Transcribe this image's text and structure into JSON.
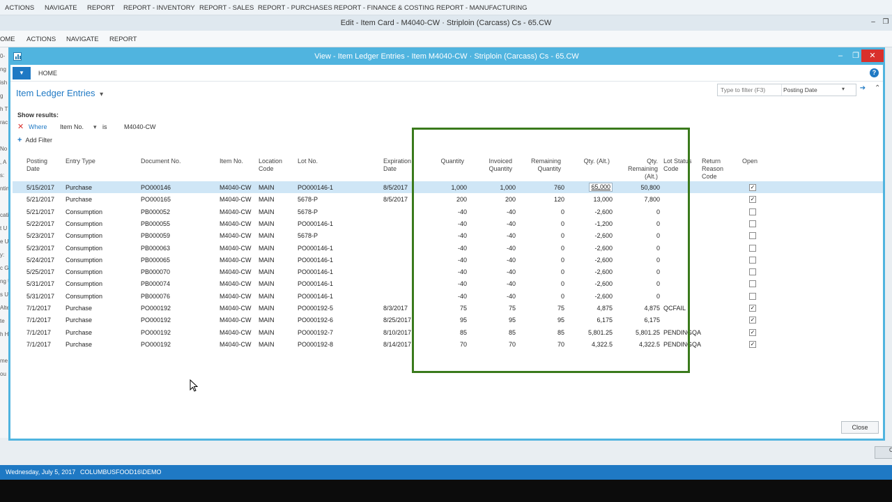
{
  "background_app": {
    "menu": [
      "ACTIONS",
      "NAVIGATE",
      "REPORT",
      "REPORT - INVENTORY",
      "REPORT - SALES",
      "REPORT - PURCHASES",
      "REPORT - FINANCE & COSTING",
      "REPORT - MANUFACTURING"
    ],
    "title": "Edit - Item Card - M4040-CW · Striploin (Carcass) Cs - 65.CW",
    "ribbon": [
      "OME",
      "ACTIONS",
      "NAVIGATE",
      "REPORT"
    ],
    "left_fragments": [
      "0-",
      "ng",
      "ish",
      "g",
      "h T",
      "rac",
      "",
      "No",
      ", A",
      "s:",
      "ntin",
      "",
      "cati",
      "t U",
      "e U",
      "y:",
      "c G",
      "ng U",
      "s U",
      "Alte",
      "te",
      "h H",
      "",
      "me",
      "ou"
    ],
    "corner_btn": "C"
  },
  "window": {
    "title": "View - Item Ledger Entries - Item M4040-CW · Striploin (Carcass) Cs - 65.CW",
    "minimize": "–",
    "maximize": "❐",
    "close": "✕"
  },
  "ribbon": {
    "tab": "HOME",
    "dropdown": "▼",
    "help": "?"
  },
  "page": {
    "title": "Item Ledger Entries",
    "title_chevron": "▾"
  },
  "search": {
    "placeholder": "Type to filter (F3)",
    "field": "Posting Date",
    "chevron": "▾",
    "go": "➔",
    "collapse": "⌃"
  },
  "filters": {
    "show_results": "Show results:",
    "remove": "✕",
    "where": "Where",
    "field": "Item No.",
    "field_chevron": "▾",
    "operator": "is",
    "value": "M4040-CW",
    "add_label": "Add Filter",
    "add_icon": "+"
  },
  "columns": {
    "posting_date": "Posting\nDate",
    "entry_type": "Entry Type",
    "document_no": "Document No.",
    "item_no": "Item No.",
    "location_code": "Location\nCode",
    "lot_no": "Lot No.",
    "expiration_date": "Expiration\nDate",
    "quantity": "Quantity",
    "invoiced_quantity": "Invoiced\nQuantity",
    "remaining_quantity": "Remaining\nQuantity",
    "qty_alt": "Qty. (Alt.)",
    "qty_remaining_alt": "Qty.\nRemaining\n(Alt.)",
    "lot_status_code": "Lot Status\nCode",
    "return_reason_code": "Return\nReason\nCode",
    "open": "Open"
  },
  "rows": [
    {
      "date": "5/15/2017",
      "type": "Purchase",
      "doc": "PO000146",
      "item": "M4040-CW",
      "loc": "MAIN",
      "lot": "PO000146-1",
      "exp": "8/5/2017",
      "qty": "1,000",
      "inv": "1,000",
      "rem": "760",
      "alt": "65,000",
      "remalt": "50,800",
      "lotstatus": "",
      "reason": "",
      "open": "✓"
    },
    {
      "date": "5/21/2017",
      "type": "Purchase",
      "doc": "PO000165",
      "item": "M4040-CW",
      "loc": "MAIN",
      "lot": "5678-P",
      "exp": "8/5/2017",
      "qty": "200",
      "inv": "200",
      "rem": "120",
      "alt": "13,000",
      "remalt": "7,800",
      "lotstatus": "",
      "reason": "",
      "open": "✓"
    },
    {
      "date": "5/21/2017",
      "type": "Consumption",
      "doc": "PB000052",
      "item": "M4040-CW",
      "loc": "MAIN",
      "lot": "5678-P",
      "exp": "",
      "qty": "-40",
      "inv": "-40",
      "rem": "0",
      "alt": "-2,600",
      "remalt": "0",
      "lotstatus": "",
      "reason": "",
      "open": ""
    },
    {
      "date": "5/22/2017",
      "type": "Consumption",
      "doc": "PB000055",
      "item": "M4040-CW",
      "loc": "MAIN",
      "lot": "PO000146-1",
      "exp": "",
      "qty": "-40",
      "inv": "-40",
      "rem": "0",
      "alt": "-1,200",
      "remalt": "0",
      "lotstatus": "",
      "reason": "",
      "open": ""
    },
    {
      "date": "5/23/2017",
      "type": "Consumption",
      "doc": "PB000059",
      "item": "M4040-CW",
      "loc": "MAIN",
      "lot": "5678-P",
      "exp": "",
      "qty": "-40",
      "inv": "-40",
      "rem": "0",
      "alt": "-2,600",
      "remalt": "0",
      "lotstatus": "",
      "reason": "",
      "open": ""
    },
    {
      "date": "5/23/2017",
      "type": "Consumption",
      "doc": "PB000063",
      "item": "M4040-CW",
      "loc": "MAIN",
      "lot": "PO000146-1",
      "exp": "",
      "qty": "-40",
      "inv": "-40",
      "rem": "0",
      "alt": "-2,600",
      "remalt": "0",
      "lotstatus": "",
      "reason": "",
      "open": ""
    },
    {
      "date": "5/24/2017",
      "type": "Consumption",
      "doc": "PB000065",
      "item": "M4040-CW",
      "loc": "MAIN",
      "lot": "PO000146-1",
      "exp": "",
      "qty": "-40",
      "inv": "-40",
      "rem": "0",
      "alt": "-2,600",
      "remalt": "0",
      "lotstatus": "",
      "reason": "",
      "open": ""
    },
    {
      "date": "5/25/2017",
      "type": "Consumption",
      "doc": "PB000070",
      "item": "M4040-CW",
      "loc": "MAIN",
      "lot": "PO000146-1",
      "exp": "",
      "qty": "-40",
      "inv": "-40",
      "rem": "0",
      "alt": "-2,600",
      "remalt": "0",
      "lotstatus": "",
      "reason": "",
      "open": ""
    },
    {
      "date": "5/31/2017",
      "type": "Consumption",
      "doc": "PB000074",
      "item": "M4040-CW",
      "loc": "MAIN",
      "lot": "PO000146-1",
      "exp": "",
      "qty": "-40",
      "inv": "-40",
      "rem": "0",
      "alt": "-2,600",
      "remalt": "0",
      "lotstatus": "",
      "reason": "",
      "open": ""
    },
    {
      "date": "5/31/2017",
      "type": "Consumption",
      "doc": "PB000076",
      "item": "M4040-CW",
      "loc": "MAIN",
      "lot": "PO000146-1",
      "exp": "",
      "qty": "-40",
      "inv": "-40",
      "rem": "0",
      "alt": "-2,600",
      "remalt": "0",
      "lotstatus": "",
      "reason": "",
      "open": ""
    },
    {
      "date": "7/1/2017",
      "type": "Purchase",
      "doc": "PO000192",
      "item": "M4040-CW",
      "loc": "MAIN",
      "lot": "PO000192-5",
      "exp": "8/3/2017",
      "qty": "75",
      "inv": "75",
      "rem": "75",
      "alt": "4,875",
      "remalt": "4,875",
      "lotstatus": "QCFAIL",
      "reason": "",
      "open": "✓"
    },
    {
      "date": "7/1/2017",
      "type": "Purchase",
      "doc": "PO000192",
      "item": "M4040-CW",
      "loc": "MAIN",
      "lot": "PO000192-6",
      "exp": "8/25/2017",
      "qty": "95",
      "inv": "95",
      "rem": "95",
      "alt": "6,175",
      "remalt": "6,175",
      "lotstatus": "",
      "reason": "",
      "open": "✓"
    },
    {
      "date": "7/1/2017",
      "type": "Purchase",
      "doc": "PO000192",
      "item": "M4040-CW",
      "loc": "MAIN",
      "lot": "PO000192-7",
      "exp": "8/10/2017",
      "qty": "85",
      "inv": "85",
      "rem": "85",
      "alt": "5,801.25",
      "remalt": "5,801.25",
      "lotstatus": "PENDINGQA",
      "reason": "",
      "open": "✓"
    },
    {
      "date": "7/1/2017",
      "type": "Purchase",
      "doc": "PO000192",
      "item": "M4040-CW",
      "loc": "MAIN",
      "lot": "PO000192-8",
      "exp": "8/14/2017",
      "qty": "70",
      "inv": "70",
      "rem": "70",
      "alt": "4,322.5",
      "remalt": "4,322.5",
      "lotstatus": "PENDINGQA",
      "reason": "",
      "open": "✓"
    }
  ],
  "buttons": {
    "close": "Close"
  },
  "status": {
    "date": "Wednesday, July 5, 2017",
    "user": "COLUMBUSFOOD16\\DEMO"
  },
  "colors": {
    "accent": "#50b4df",
    "link": "#1f79c4",
    "highlight": "#3a7a1c",
    "selected_row": "#cfe6f6",
    "remove": "#d9302c"
  }
}
